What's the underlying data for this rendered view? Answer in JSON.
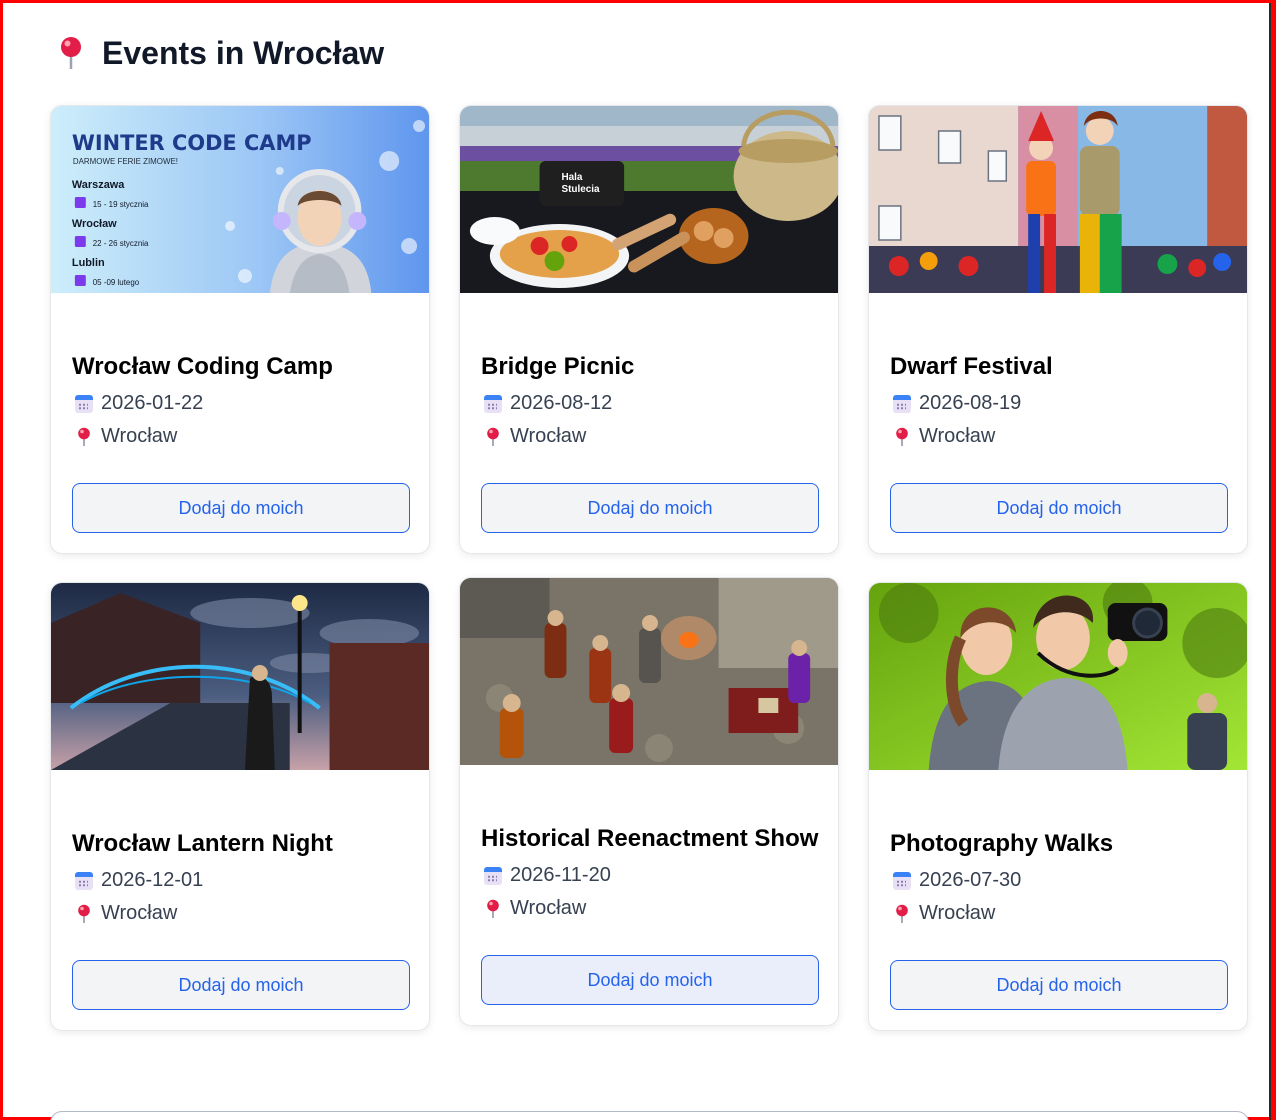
{
  "page": {
    "title": "Events in Wrocław",
    "title_icon": "pushpin-icon"
  },
  "events": [
    {
      "title": "Wrocław Coding Camp",
      "date": "2026-01-22",
      "location": "Wrocław",
      "button": "Dodaj do moich",
      "image": {
        "headline": "WINTER CODE CAMP",
        "subhead": "DARMOWE FERIE ZIMOWE!",
        "cities": [
          {
            "name": "Warszawa",
            "dates": "15 - 19 stycznia"
          },
          {
            "name": "Wrocław",
            "dates": "22 - 26 stycznia"
          },
          {
            "name": "Lublin",
            "dates": "05 -09 lutego"
          }
        ]
      }
    },
    {
      "title": "Bridge Picnic",
      "date": "2026-08-12",
      "location": "Wrocław",
      "button": "Dodaj do moich",
      "image": {
        "bag_label_1": "Hala",
        "bag_label_2": "Stulecia"
      }
    },
    {
      "title": "Dwarf Festival",
      "date": "2026-08-19",
      "location": "Wrocław",
      "button": "Dodaj do moich"
    },
    {
      "title": "Wrocław Lantern Night",
      "date": "2026-12-01",
      "location": "Wrocław",
      "button": "Dodaj do moich"
    },
    {
      "title": "Historical Reenactment Show",
      "date": "2026-11-20",
      "location": "Wrocław",
      "button": "Dodaj do moich"
    },
    {
      "title": "Photography Walks",
      "date": "2026-07-30",
      "location": "Wrocław",
      "button": "Dodaj do moich"
    }
  ],
  "colors": {
    "accent": "#2563eb",
    "frame": "#ff0000"
  }
}
